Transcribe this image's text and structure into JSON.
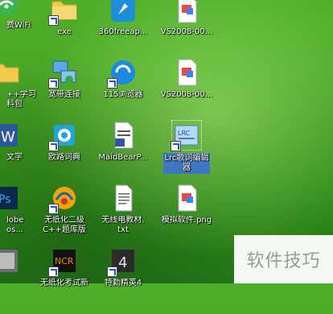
{
  "desktop": {
    "icons": [
      {
        "id": "wifi",
        "label": "费WiFi"
      },
      {
        "id": "exe",
        "label": "exe"
      },
      {
        "id": "360",
        "label": "360freeap..."
      },
      {
        "id": "vs1",
        "label": "VS2008-00..."
      },
      {
        "id": "cpp",
        "label": "++学习\n料包"
      },
      {
        "id": "bb",
        "label": "宽带连接"
      },
      {
        "id": "115",
        "label": "115浏览器"
      },
      {
        "id": "vs2",
        "label": "VS2008-00..."
      },
      {
        "id": "word",
        "label": "文字"
      },
      {
        "id": "dict",
        "label": "欧路词典"
      },
      {
        "id": "maid",
        "label": "MaidBearP..."
      },
      {
        "id": "lrc",
        "label": "Lrc歌词编辑\n器"
      },
      {
        "id": "ps",
        "label": "lobe\nos..."
      },
      {
        "id": "paperless",
        "label": "无纸化二级\nC++题库版"
      },
      {
        "id": "wire",
        "label": "无线电教材.\ntxt"
      },
      {
        "id": "sim",
        "label": "模拟软件.png"
      },
      {
        "id": "p1",
        "label": ""
      },
      {
        "id": "ncr",
        "label": "无纸化考试新"
      },
      {
        "id": "special",
        "label": "特勤精英4"
      }
    ]
  },
  "watermark": {
    "text": "软件技巧"
  }
}
